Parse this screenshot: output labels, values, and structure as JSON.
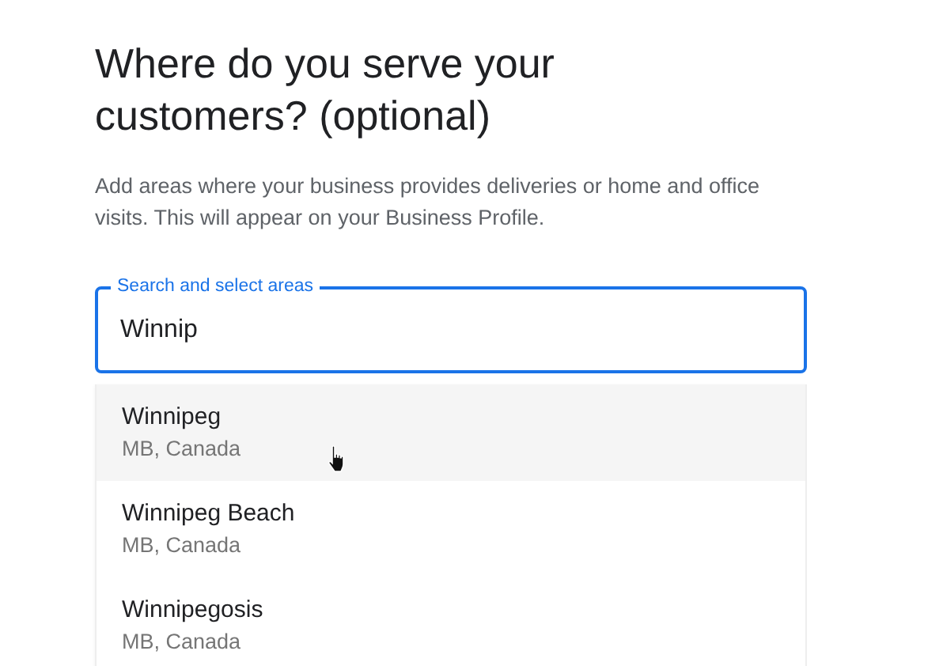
{
  "heading": "Where do you serve your customers? (optional)",
  "description": "Add areas where your business provides deliveries or home and office visits. This will appear on your Business Profile.",
  "search": {
    "label": "Search and select areas",
    "value": "Winnip"
  },
  "suggestions": [
    {
      "name": "Winnipeg",
      "region": "MB, Canada",
      "selected": true
    },
    {
      "name": "Winnipeg Beach",
      "region": "MB, Canada",
      "selected": false
    },
    {
      "name": "Winnipegosis",
      "region": "MB, Canada",
      "selected": false
    }
  ]
}
